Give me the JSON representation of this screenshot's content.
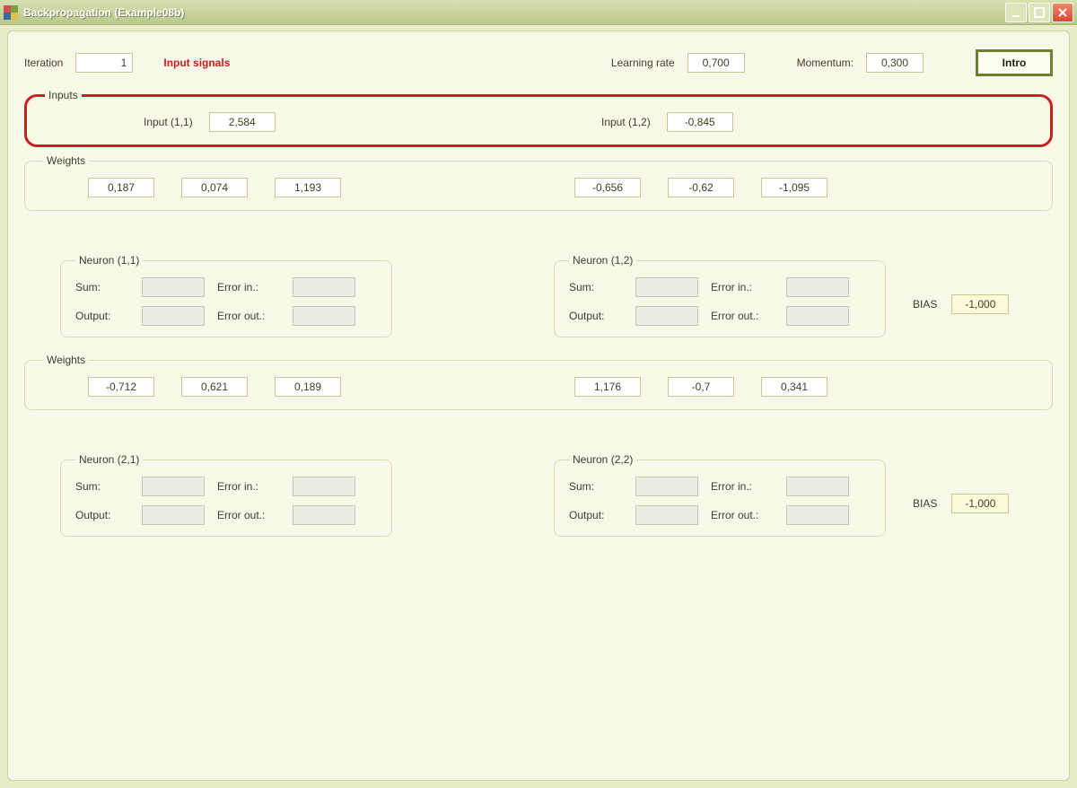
{
  "window": {
    "title": "Backpropagation (Example08b)"
  },
  "top": {
    "iteration_label": "Iteration",
    "iteration_value": "1",
    "status": "Input signals",
    "lr_label": "Learning rate",
    "lr_value": "0,700",
    "mom_label": "Momentum:",
    "mom_value": "0,300",
    "intro_label": "Intro"
  },
  "inputs": {
    "legend": "Inputs",
    "in11_label": "Input (1,1)",
    "in11_value": "2,584",
    "in12_label": "Input (1,2)",
    "in12_value": "-0,845"
  },
  "weights1": {
    "legend": "Weights",
    "left": [
      "0,187",
      "0,074",
      "1,193"
    ],
    "right": [
      "-0,656",
      "-0,62",
      "-1,095"
    ]
  },
  "neurons1": {
    "n11_legend": "Neuron (1,1)",
    "n12_legend": "Neuron (1,2)",
    "sum_label": "Sum:",
    "errin_label": "Error in.:",
    "output_label": "Output:",
    "errout_label": "Error out.:",
    "bias_label": "BIAS",
    "bias_value": "-1,000"
  },
  "weights2": {
    "legend": "Weights",
    "left": [
      "-0,712",
      "0,621",
      "0,189"
    ],
    "right": [
      "1,176",
      "-0,7",
      "0,341"
    ]
  },
  "neurons2": {
    "n21_legend": "Neuron (2,1)",
    "n22_legend": "Neuron (2,2)",
    "bias_value": "-1,000"
  }
}
